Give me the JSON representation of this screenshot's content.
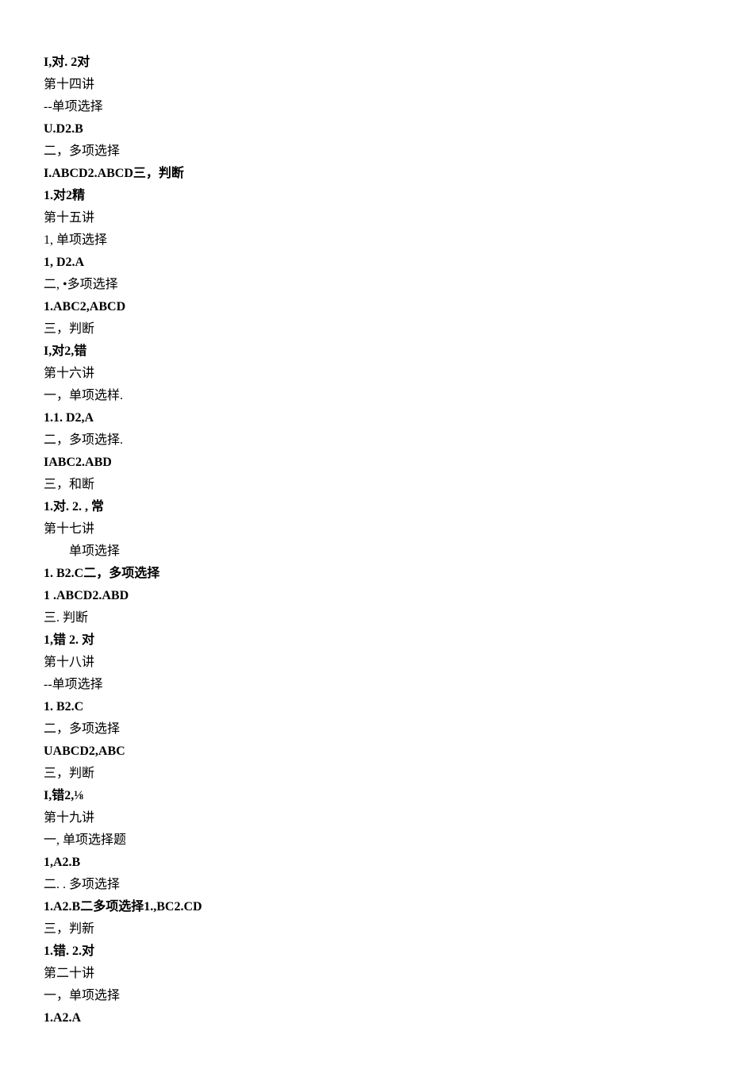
{
  "lines": [
    {
      "cls": "bold",
      "txt": "I,对. 2对"
    },
    {
      "cls": "",
      "txt": "第十四讲"
    },
    {
      "cls": "",
      "txt": "--单项选择"
    },
    {
      "cls": "bold",
      "txt": "U.D2.B"
    },
    {
      "cls": "",
      "txt": "二，多项选择"
    },
    {
      "cls": "bold",
      "txt": "I.ABCD2.ABCD三，判断"
    },
    {
      "cls": "bold",
      "txt": "1.对2精"
    },
    {
      "cls": "",
      "txt": "第十五讲"
    },
    {
      "cls": "",
      "txt": "1, 单项选择"
    },
    {
      "cls": "bold",
      "txt": "1,   D2.A"
    },
    {
      "cls": "",
      "txt": "二, •多项选择"
    },
    {
      "cls": "bold",
      "txt": "1.ABC2,ABCD"
    },
    {
      "cls": "",
      "txt": "三，判断"
    },
    {
      "cls": "bold",
      "txt": "I,对2,错"
    },
    {
      "cls": "",
      "txt": "第十六讲"
    },
    {
      "cls": "",
      "txt": "一，单项选样."
    },
    {
      "cls": "bold",
      "txt": "1.1.  D2,A"
    },
    {
      "cls": "",
      "txt": "二，多项选择."
    },
    {
      "cls": "bold",
      "txt": "IABC2.ABD"
    },
    {
      "cls": "",
      "txt": "三，和断"
    },
    {
      "cls": "bold",
      "txt": "1.对. 2. , 常"
    },
    {
      "cls": "",
      "txt": "第十七讲"
    },
    {
      "cls": "indent",
      "txt": "单项选择"
    },
    {
      "cls": "bold",
      "txt": "1.   B2.C二，多项选择"
    },
    {
      "cls": "bold",
      "txt": "1    .ABCD2.ABD"
    },
    {
      "cls": "",
      "txt": "三. 判断"
    },
    {
      "cls": "bold",
      "txt": "1,错        2. 对"
    },
    {
      "cls": "",
      "txt": "第十八讲"
    },
    {
      "cls": "",
      "txt": "--单项选择"
    },
    {
      "cls": "bold",
      "txt": "1.   B2.C"
    },
    {
      "cls": "",
      "txt": "二，多项选择"
    },
    {
      "cls": "bold",
      "txt": "UABCD2,ABC"
    },
    {
      "cls": "",
      "txt": "三，判断"
    },
    {
      "cls": "bold",
      "txt": "I,错2,⅛"
    },
    {
      "cls": "",
      "txt": "第十九讲"
    },
    {
      "cls": "",
      "txt": "一, 单项选择题"
    },
    {
      "cls": "bold",
      "txt": "1,A2.B"
    },
    {
      "cls": "",
      "txt": "二. . 多项选择"
    },
    {
      "cls": "bold",
      "txt": "1.A2.B二多项选择1.,BC2.CD"
    },
    {
      "cls": "",
      "txt": "三，判新"
    },
    {
      "cls": "bold",
      "txt": "1.错. 2.对"
    },
    {
      "cls": "",
      "txt": "第二十讲"
    },
    {
      "cls": "",
      "txt": "一，单项选择"
    },
    {
      "cls": "bold",
      "txt": "1.A2.A"
    }
  ]
}
